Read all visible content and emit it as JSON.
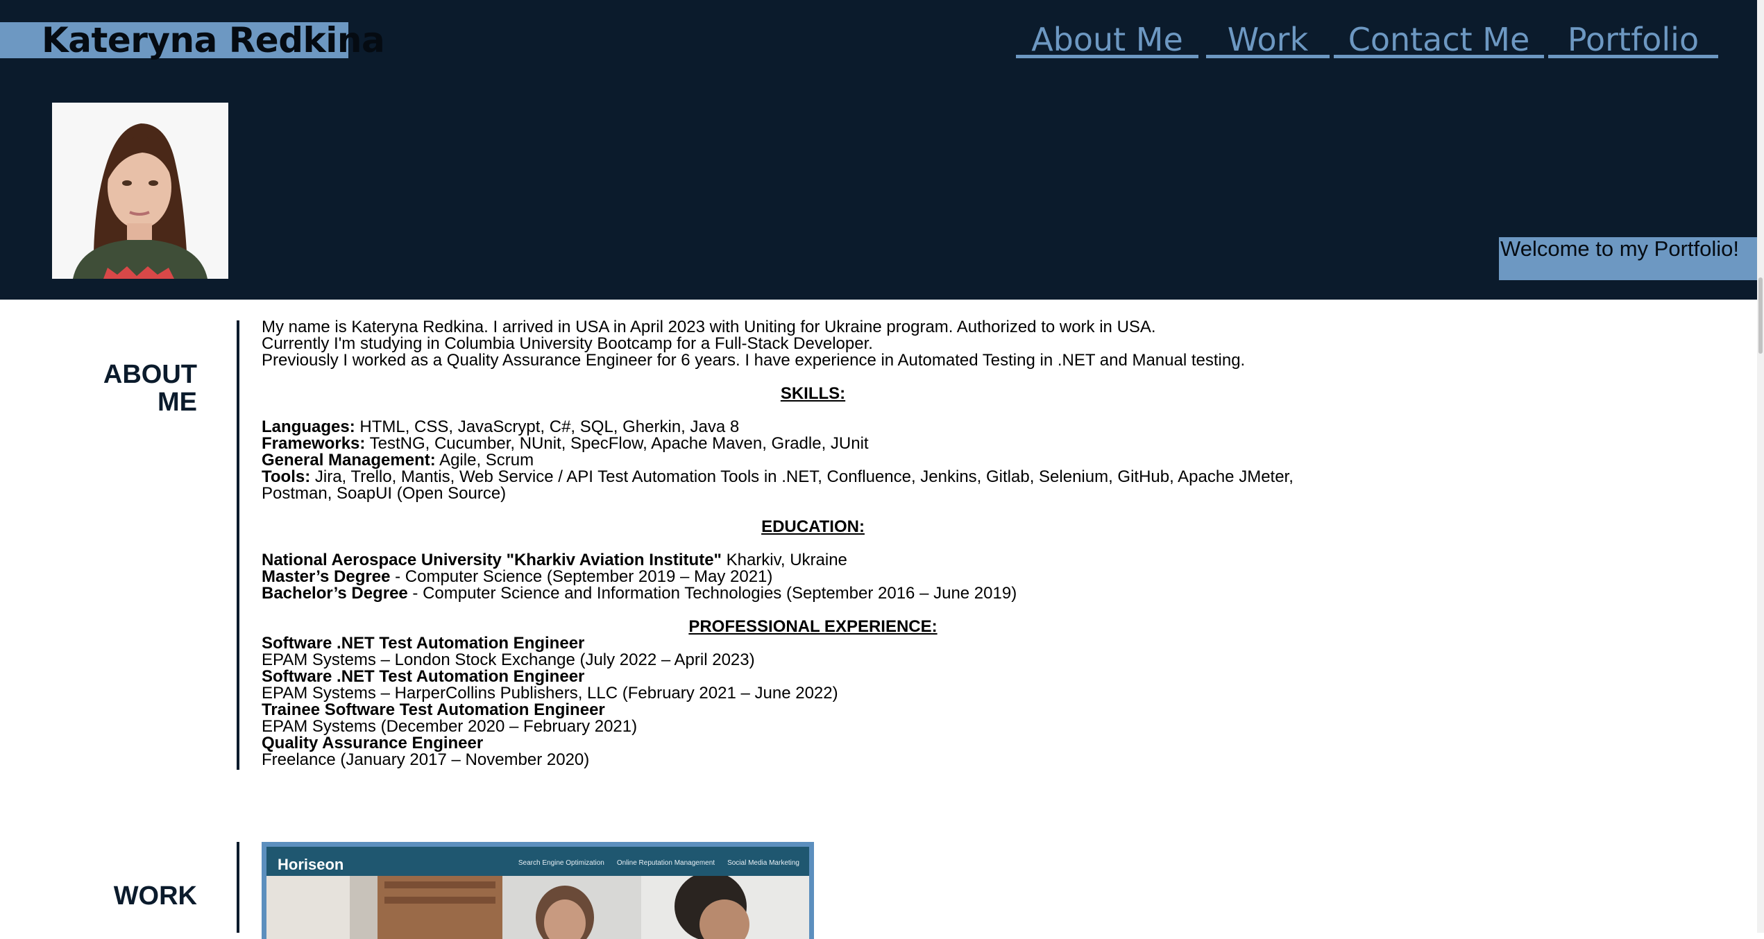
{
  "header": {
    "site_title": "Kateryna Redkina",
    "nav": [
      "About Me",
      "Work",
      "Contact Me",
      "Portfolio"
    ],
    "welcome": "Welcome to my Portfolio!"
  },
  "about": {
    "section_title_line1": "ABOUT",
    "section_title_line2": "ME",
    "intro": [
      "My name is Kateryna Redkina. I arrived in USA in April 2023 with Uniting for Ukraine program. Authorized to work in USA.",
      "Currently I'm studying in Columbia University Bootcamp for a Full-Stack Developer.",
      "Previously I worked as a Quality Assurance Engineer for 6 years. I have experience in Automated Testing in .NET and Manual testing."
    ],
    "skills_heading": "SKILLS:",
    "skills": [
      {
        "label": "Languages:",
        "value": " HTML, CSS, JavaScrypt, C#, SQL, Gherkin, Java 8"
      },
      {
        "label": "Frameworks:",
        "value": " TestNG, Cucumber, NUnit, SpecFlow, Apache Maven, Gradle, JUnit"
      },
      {
        "label": "General Management:",
        "value": " Agile, Scrum"
      },
      {
        "label": "Tools:",
        "value": " Jira, Trello, Mantis, Web Service / API Test Automation Tools in .NET, Confluence, Jenkins, Gitlab, Selenium, GitHub, Apache JMeter,"
      }
    ],
    "tools_line2": "Postman, SoapUI (Open Source)",
    "education_heading": "EDUCATION:",
    "education": [
      {
        "label": "National Aerospace University \"Kharkiv Aviation Institute\"",
        "value": " Kharkiv, Ukraine"
      },
      {
        "label": "Master’s Degree",
        "value": " - Computer Science (September 2019 – May 2021)"
      },
      {
        "label": "Bachelor’s Degree",
        "value": " - Computer Science and Information Technologies (September 2016 – June 2019)"
      }
    ],
    "experience_heading": "PROFESSIONAL EXPERIENCE:",
    "experience": [
      {
        "title": "Software .NET Test Automation Engineer",
        "detail": "EPAM Systems – London Stock Exchange (July 2022 – April 2023)"
      },
      {
        "title": "Software .NET Test Automation Engineer",
        "detail": "EPAM Systems – HarperCollins Publishers, LLC (February 2021 – June 2022)"
      },
      {
        "title": "Trainee Software Test Automation Engineer",
        "detail": "EPAM Systems (December 2020 – February 2021)"
      },
      {
        "title": "Quality Assurance Engineer",
        "detail": "Freelance (January 2017 – November 2020)"
      }
    ]
  },
  "work": {
    "section_title": "WORK",
    "project": {
      "brand": "Horiseon",
      "nav": [
        "Search Engine Optimization",
        "Online Reputation Management",
        "Social Media Marketing"
      ]
    }
  },
  "colors": {
    "navy": "#0b1b2c",
    "accent_blue": "#6d98c2",
    "white": "#ffffff"
  }
}
